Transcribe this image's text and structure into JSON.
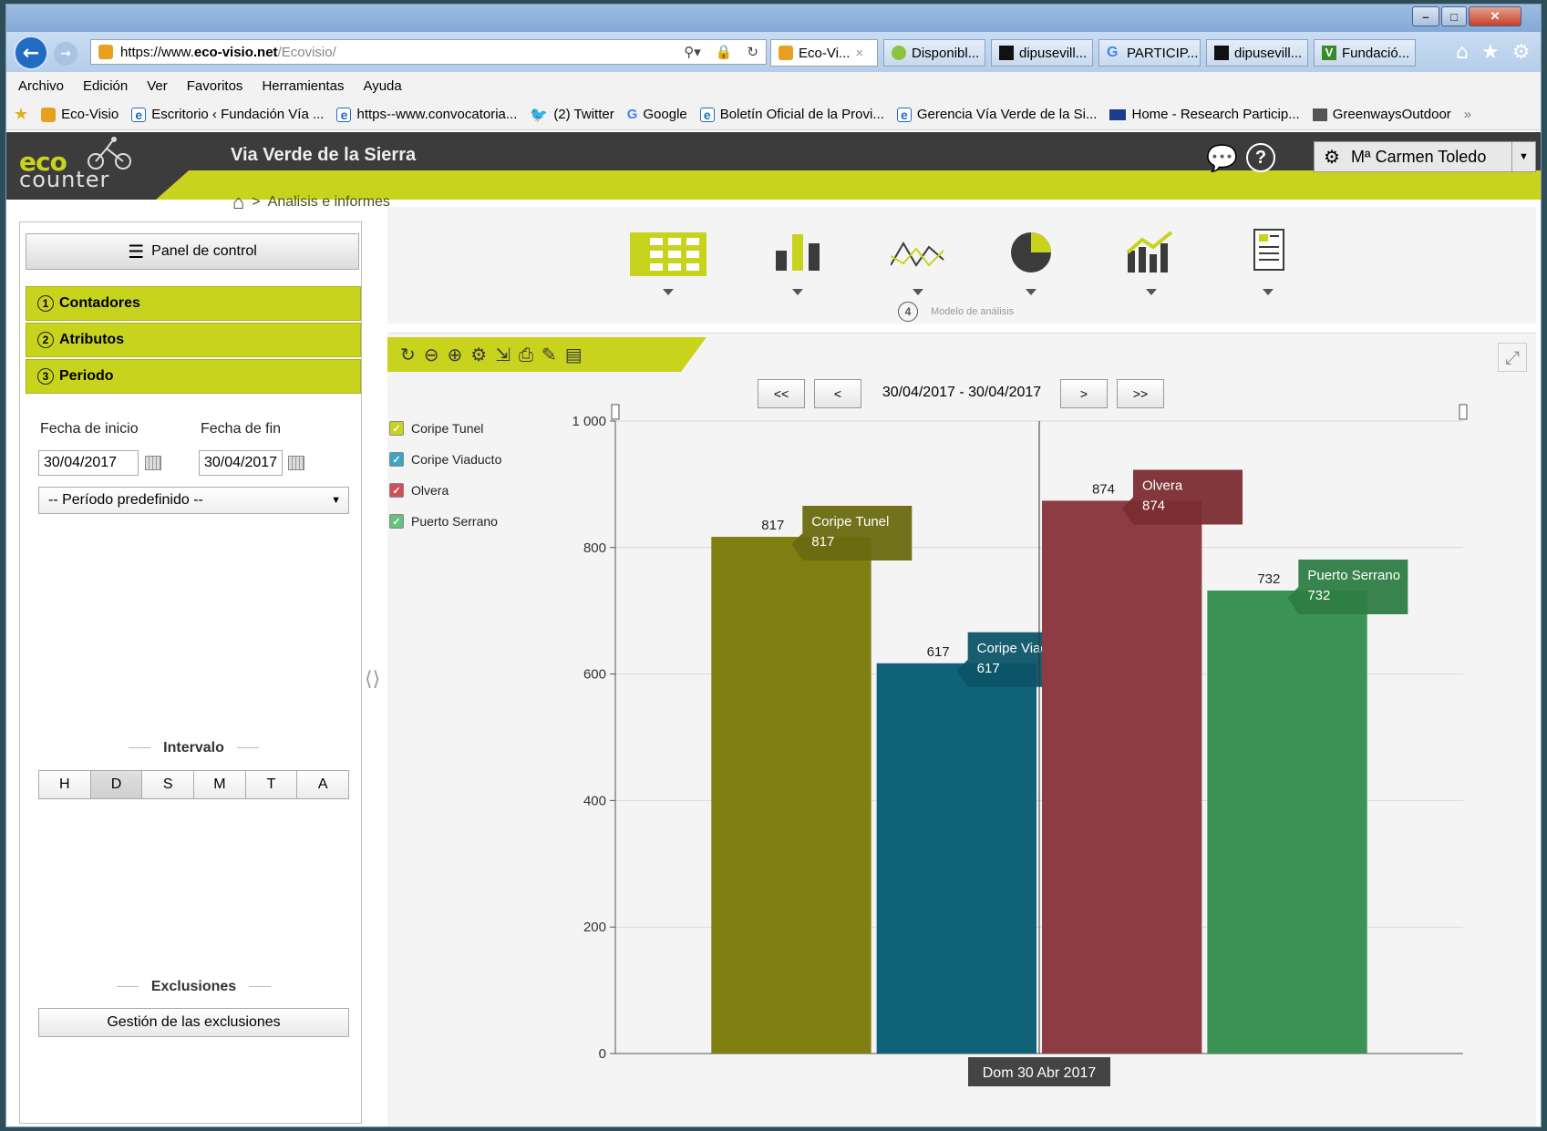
{
  "browser": {
    "url_prefix": "https://www.",
    "url_domain": "eco-visio.net",
    "url_path": "/Ecovisio/",
    "tabs": [
      {
        "label": "Eco-Vi...",
        "close": "×",
        "icon": "eco-visio-icon",
        "active": true
      },
      {
        "label": "Disponibl...",
        "icon": "flower-icon",
        "active": false
      },
      {
        "label": "dipusevill...",
        "icon": "black-square-icon",
        "active": false
      },
      {
        "label": "PARTICIP...",
        "icon": "google-icon",
        "active": false
      },
      {
        "label": "dipusevill...",
        "icon": "black-square-icon",
        "active": false
      },
      {
        "label": "Fundació...",
        "icon": "green-v-icon",
        "active": false
      }
    ],
    "menu": [
      "Archivo",
      "Edición",
      "Ver",
      "Favoritos",
      "Herramientas",
      "Ayuda"
    ],
    "favorites": [
      {
        "label": "Eco-Visio",
        "icon": "eco-visio-icon"
      },
      {
        "label": "Escritorio ‹ Fundación Vía ...",
        "icon": "ie-page-icon"
      },
      {
        "label": "https--www.convocatoria...",
        "icon": "ie-page-icon"
      },
      {
        "label": "(2) Twitter",
        "icon": "twitter-icon"
      },
      {
        "label": "Google",
        "icon": "google-icon"
      },
      {
        "label": "Boletín Oficial de la Provi...",
        "icon": "ie-page-icon"
      },
      {
        "label": "Gerencia Vía Verde de la Si...",
        "icon": "ie-page-icon"
      },
      {
        "label": "Home - Research Particip...",
        "icon": "flag-icon"
      },
      {
        "label": "GreenwaysOutdoor",
        "icon": "tree-icon"
      }
    ],
    "more": "»"
  },
  "app": {
    "logo_line1": "eco",
    "logo_line2": "counter",
    "site_name": "Via Verde de la Sierra",
    "breadcrumb_sep": ">",
    "breadcrumb": "Analisis e informes",
    "user": "Mª Carmen Toledo",
    "colors": {
      "accent": "#c8d31e",
      "header": "#3c3c3c"
    }
  },
  "sidebar": {
    "panel_button": "Panel de control",
    "sections": [
      {
        "num": "1",
        "label": "Contadores"
      },
      {
        "num": "2",
        "label": "Atributos"
      },
      {
        "num": "3",
        "label": "Periodo"
      }
    ],
    "start_label": "Fecha de inicio",
    "end_label": "Fecha de fin",
    "start_date": "30/04/2017",
    "end_date": "30/04/2017",
    "preset": "-- Período predefinido --",
    "interval_title": "Intervalo",
    "intervals": [
      "H",
      "D",
      "S",
      "M",
      "T",
      "A"
    ],
    "interval_selected": "D",
    "exclusions_title": "Exclusiones",
    "exclusions_button": "Gestión de las exclusiones"
  },
  "toolbar": {
    "step_num": "4",
    "step_label": "Modelo de análisis",
    "view_icons": [
      "table-icon",
      "bar-chart-icon",
      "line-chart-icon",
      "pie-chart-icon",
      "trend-chart-icon",
      "report-icon"
    ]
  },
  "chart_tools": [
    "refresh-icon",
    "zoom-out-icon",
    "zoom-in-icon",
    "settings-icon",
    "export-icon",
    "print-icon",
    "pencil-icon",
    "comment-icon"
  ],
  "pager": {
    "first": "<<",
    "prev": "<",
    "range": "30/04/2017 - 30/04/2017",
    "next": ">",
    "last": ">>"
  },
  "chart_data": {
    "type": "bar",
    "categories": [
      "Dom 30 Abr 2017"
    ],
    "series": [
      {
        "name": "Coripe Tunel",
        "values": [
          817
        ],
        "color": "#7f7f12",
        "label_color": "#6a6a10"
      },
      {
        "name": "Coripe Viaducto",
        "values": [
          617
        ],
        "color": "#0f6278",
        "label_color": "#0d5468"
      },
      {
        "name": "Olvera",
        "values": [
          874
        ],
        "color": "#8c3c42",
        "label_color": "#7a2c31"
      },
      {
        "name": "Puerto Serrano",
        "values": [
          732
        ],
        "color": "#3b9355",
        "label_color": "#2e7d45"
      }
    ],
    "y_ticks": [
      0,
      200,
      400,
      600,
      800,
      1000
    ],
    "y_tick_labels": [
      "0",
      "200",
      "400",
      "600",
      "800",
      "1 000"
    ],
    "ylim": [
      0,
      1000
    ],
    "grid": true,
    "legend_position": "left",
    "hover_category": "Dom 30 Abr 2017"
  }
}
